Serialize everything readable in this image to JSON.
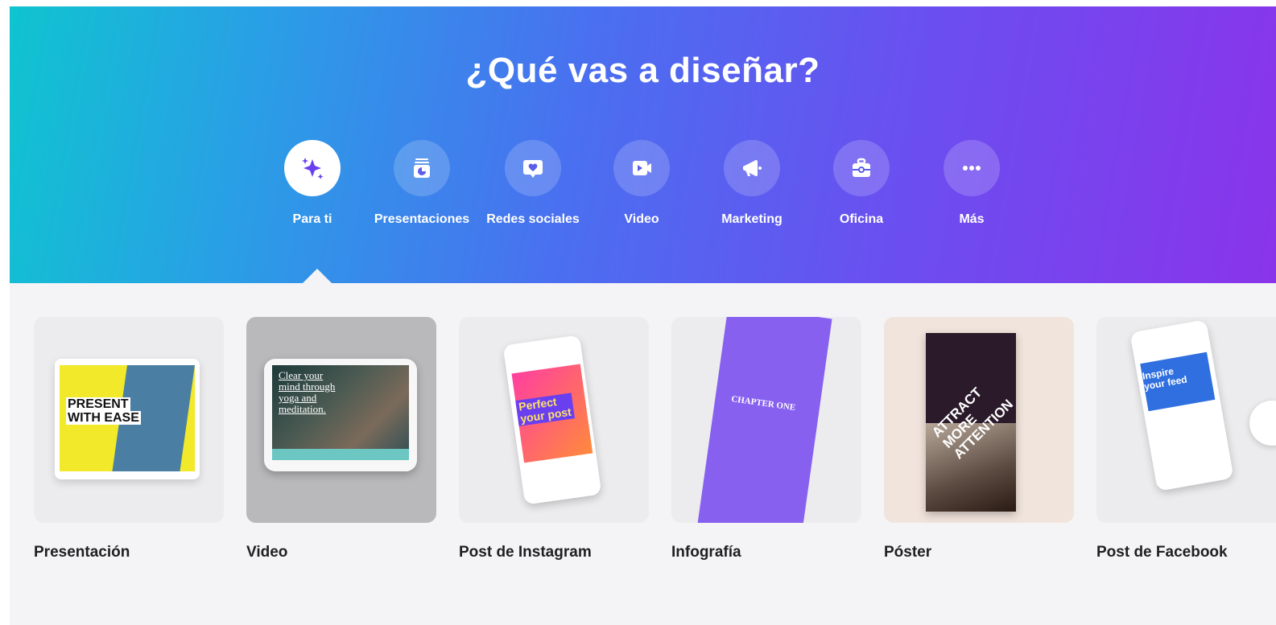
{
  "hero": {
    "title": "¿Qué vas a diseñar?",
    "gradient": [
      "#0fc4d0",
      "#4a6ff0",
      "#8a34ea"
    ]
  },
  "categories": [
    {
      "label": "Para ti",
      "icon": "sparkle-icon",
      "active": true
    },
    {
      "label": "Presentaciones",
      "icon": "presentation-icon",
      "active": false
    },
    {
      "label": "Redes sociales",
      "icon": "heart-bubble-icon",
      "active": false
    },
    {
      "label": "Video",
      "icon": "video-camera-icon",
      "active": false
    },
    {
      "label": "Marketing",
      "icon": "megaphone-icon",
      "active": false
    },
    {
      "label": "Oficina",
      "icon": "briefcase-icon",
      "active": false
    },
    {
      "label": "Más",
      "icon": "more-dots-icon",
      "active": false
    }
  ],
  "designs": [
    {
      "label": "Presentación",
      "thumb_text": [
        "PRESENT",
        "WITH EASE"
      ]
    },
    {
      "label": "Video",
      "thumb_text": [
        "Clear your",
        "mind through",
        "yoga and",
        "meditation."
      ]
    },
    {
      "label": "Post de Instagram",
      "thumb_text": [
        "Perfect",
        "your post"
      ]
    },
    {
      "label": "Infografía",
      "thumb_text": [
        "CHAPTER ONE"
      ]
    },
    {
      "label": "Póster",
      "thumb_text": [
        "ATTRACT",
        "MORE",
        "ATTENTION"
      ]
    },
    {
      "label": "Post de Facebook",
      "thumb_text": [
        "Inspire",
        "your feed"
      ]
    }
  ],
  "colors": {
    "active_icon": "#6a3ff0",
    "page_bg": "#f4f4f6"
  }
}
